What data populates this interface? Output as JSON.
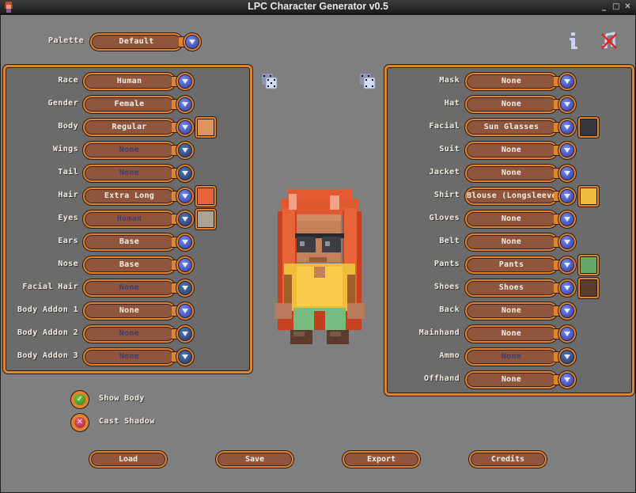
{
  "window": {
    "title": "LPC Character Generator v0.5",
    "controls": [
      "minimize",
      "maximize",
      "close"
    ]
  },
  "palette": {
    "label": "Palette",
    "value": "Default"
  },
  "toolbar_icons": {
    "info": "info-icon",
    "sound_off": "sound-muted-icon"
  },
  "colors": {
    "accent": "#e0852e",
    "field": "#8f553d",
    "panel": "#6b6b6b",
    "background": "#7f7f7f",
    "disabled_text": "#3e3e70"
  },
  "left_panel": {
    "rows": [
      {
        "label": "Race",
        "value": "Human",
        "disabled": false,
        "swatch": null
      },
      {
        "label": "Gender",
        "value": "Female",
        "disabled": false,
        "swatch": null
      },
      {
        "label": "Body",
        "value": "Regular",
        "disabled": false,
        "swatch": "#e0935e"
      },
      {
        "label": "Wings",
        "value": "None",
        "disabled": true,
        "swatch": null
      },
      {
        "label": "Tail",
        "value": "None",
        "disabled": true,
        "swatch": null
      },
      {
        "label": "Hair",
        "value": "Extra Long",
        "disabled": false,
        "swatch": "#e8643c"
      },
      {
        "label": "Eyes",
        "value": "Human",
        "disabled": true,
        "swatch": "#aaa497"
      },
      {
        "label": "Ears",
        "value": "Base",
        "disabled": false,
        "swatch": null
      },
      {
        "label": "Nose",
        "value": "Base",
        "disabled": false,
        "swatch": null
      },
      {
        "label": "Facial Hair",
        "value": "None",
        "disabled": true,
        "swatch": null
      },
      {
        "label": "Body Addon 1",
        "value": "None",
        "disabled": false,
        "swatch": null
      },
      {
        "label": "Body Addon 2",
        "value": "None",
        "disabled": true,
        "swatch": null
      },
      {
        "label": "Body Addon 3",
        "value": "None",
        "disabled": true,
        "swatch": null
      }
    ]
  },
  "right_panel": {
    "rows": [
      {
        "label": "Mask",
        "value": "None",
        "disabled": false,
        "swatch": null
      },
      {
        "label": "Hat",
        "value": "None",
        "disabled": false,
        "swatch": null
      },
      {
        "label": "Facial",
        "value": "Sun Glasses",
        "disabled": false,
        "swatch": "#37383c"
      },
      {
        "label": "Suit",
        "value": "None",
        "disabled": false,
        "swatch": null
      },
      {
        "label": "Jacket",
        "value": "None",
        "disabled": false,
        "swatch": null
      },
      {
        "label": "Shirt",
        "value": "Blouse (Longsleeve)",
        "disabled": false,
        "swatch": "#f0bc3c"
      },
      {
        "label": "Gloves",
        "value": "None",
        "disabled": false,
        "swatch": null
      },
      {
        "label": "Belt",
        "value": "None",
        "disabled": false,
        "swatch": null
      },
      {
        "label": "Pants",
        "value": "Pants",
        "disabled": false,
        "swatch": "#66a86a"
      },
      {
        "label": "Shoes",
        "value": "Shoes",
        "disabled": false,
        "swatch": "#5a3c2c"
      },
      {
        "label": "Back",
        "value": "None",
        "disabled": false,
        "swatch": null
      },
      {
        "label": "Mainhand",
        "value": "None",
        "disabled": false,
        "swatch": null
      },
      {
        "label": "Ammo",
        "value": "None",
        "disabled": true,
        "swatch": null
      },
      {
        "label": "Offhand",
        "value": "None",
        "disabled": false,
        "swatch": null
      }
    ]
  },
  "options": [
    {
      "label": "Show Body",
      "checked": true
    },
    {
      "label": "Cast Shadow",
      "checked": false
    }
  ],
  "buttons": {
    "load": "Load",
    "save": "Save",
    "export": "Export",
    "credits": "Credits"
  }
}
